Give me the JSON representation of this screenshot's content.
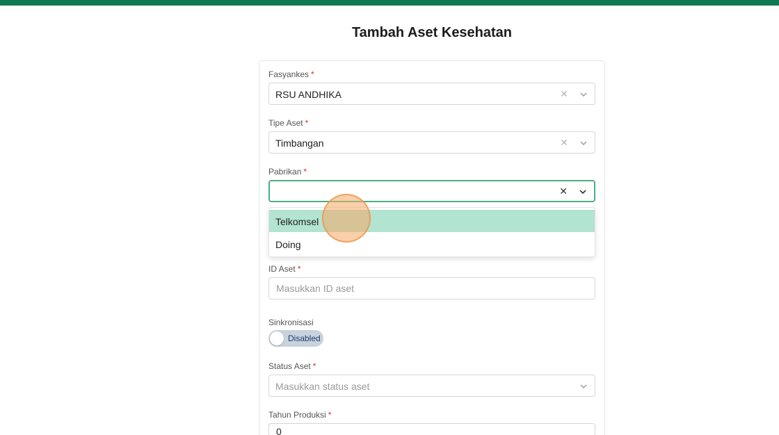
{
  "page": {
    "title": "Tambah Aset Kesehatan"
  },
  "form": {
    "fasyankes": {
      "label": "Fasyankes",
      "required": "*",
      "value": "RSU ANDHIKA",
      "clear": "✕"
    },
    "tipe_aset": {
      "label": "Tipe Aset",
      "required": "*",
      "value": "Timbangan",
      "clear": "✕"
    },
    "pabrikan": {
      "label": "Pabrikan",
      "required": "*",
      "value": "",
      "clear": "✕",
      "options": [
        "Telkomsel",
        "Doing"
      ]
    },
    "id_aset": {
      "label": "ID Aset",
      "required": "*",
      "placeholder": "Masukkan ID aset"
    },
    "sinkronisasi": {
      "label": "Sinkronisasi",
      "state": "Disabled"
    },
    "status_aset": {
      "label": "Status Aset",
      "required": "*",
      "placeholder": "Masukkan status aset"
    },
    "tahun_produksi": {
      "label": "Tahun Produksi",
      "required": "*",
      "value": "0"
    }
  },
  "colors": {
    "accent": "#0f7a52",
    "highlight": "#b3e3d1",
    "focus_border": "#4caf84",
    "required": "#d32f2f"
  },
  "icons": {
    "clear": "close-icon",
    "dropdown": "chevron-down-icon"
  }
}
